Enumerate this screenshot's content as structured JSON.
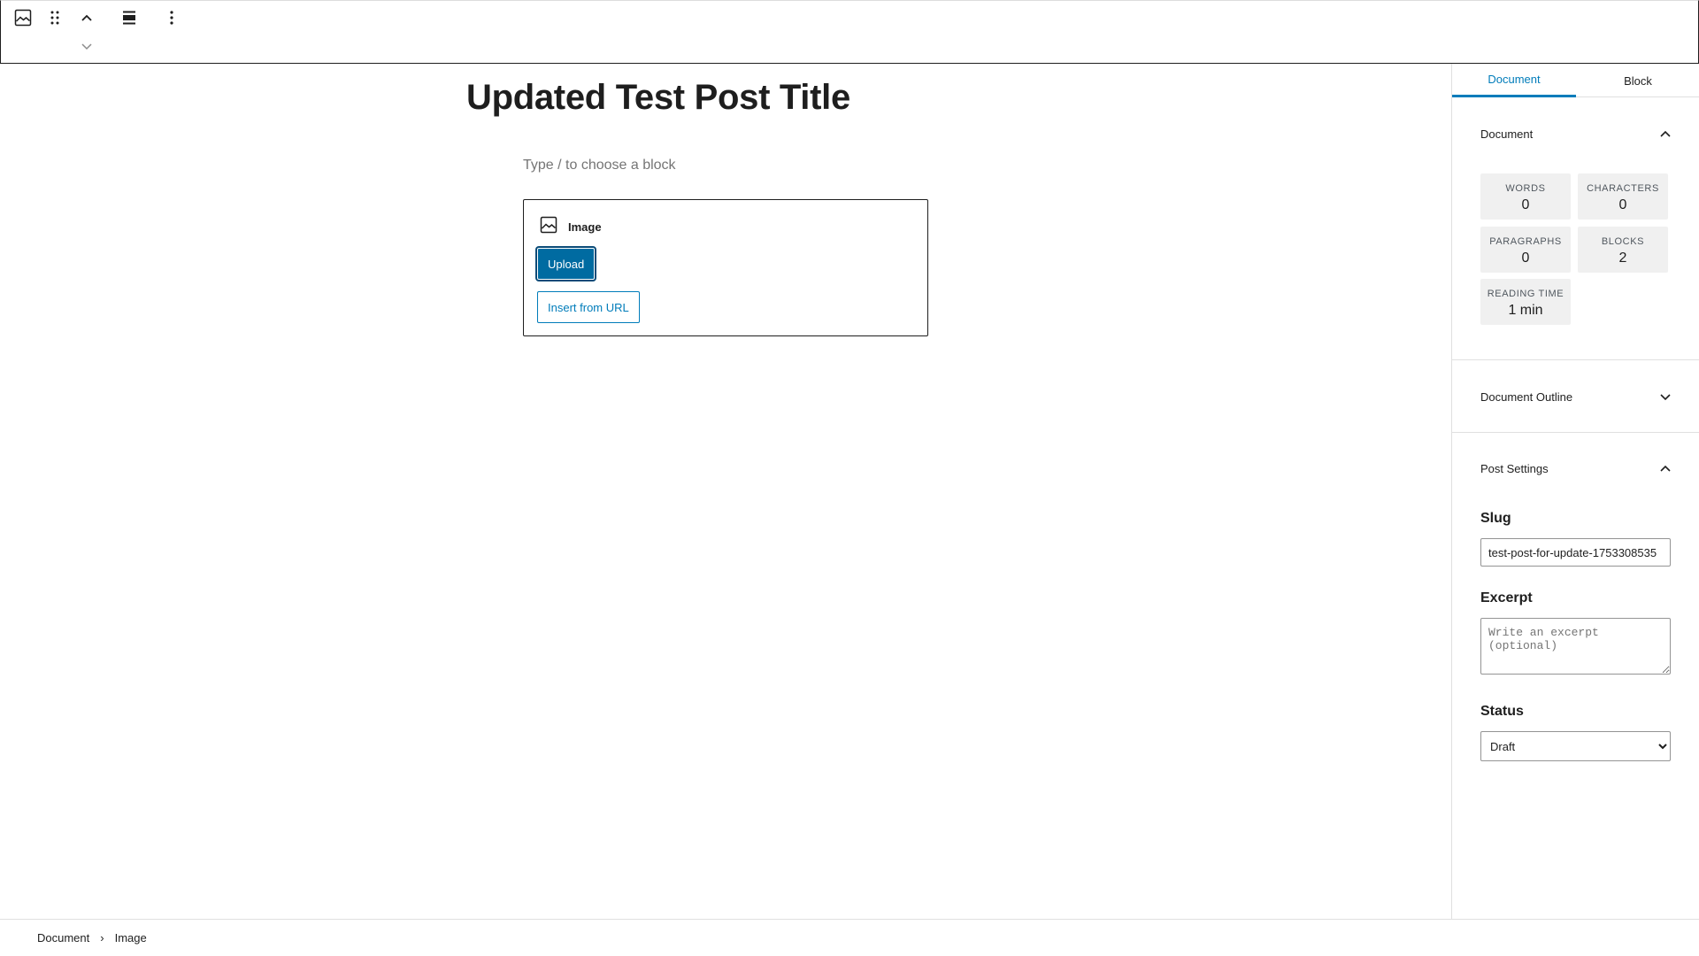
{
  "toolbar": {
    "items": [
      {
        "icon": "image-icon"
      },
      {
        "icon": "drag-handle-icon"
      },
      {
        "icon": "chevron-up-icon"
      },
      {
        "icon": "align-icon"
      },
      {
        "icon": "more-options-icon"
      },
      {
        "icon": "chevron-down-icon"
      }
    ]
  },
  "editor": {
    "post_title": "Updated Test Post Title",
    "block_placeholder": "Type / to choose a block",
    "image_block": {
      "label": "Image",
      "upload_label": "Upload",
      "insert_url_label": "Insert from URL"
    }
  },
  "sidebar": {
    "tabs": [
      {
        "label": "Document",
        "active": true
      },
      {
        "label": "Block",
        "active": false
      }
    ],
    "document_panel": {
      "title": "Document",
      "expanded": true,
      "stats": [
        {
          "label": "WORDS",
          "value": "0"
        },
        {
          "label": "CHARACTERS",
          "value": "0"
        },
        {
          "label": "PARAGRAPHS",
          "value": "0"
        },
        {
          "label": "BLOCKS",
          "value": "2"
        },
        {
          "label": "READING TIME",
          "value": "1 min"
        }
      ]
    },
    "outline_panel": {
      "title": "Document Outline",
      "expanded": false
    },
    "post_settings_panel": {
      "title": "Post Settings",
      "expanded": true,
      "slug_label": "Slug",
      "slug_value": "test-post-for-update-1753308535",
      "excerpt_label": "Excerpt",
      "excerpt_placeholder": "Write an excerpt (optional)",
      "status_label": "Status",
      "status_value": "Draft"
    }
  },
  "footer": {
    "breadcrumbs": [
      "Document",
      "Image"
    ]
  },
  "colors": {
    "accent": "#007cba",
    "primary_button": "#006ba1",
    "text": "#1e1e1e",
    "muted": "#757575",
    "stat_bg": "#f0f0f0"
  }
}
